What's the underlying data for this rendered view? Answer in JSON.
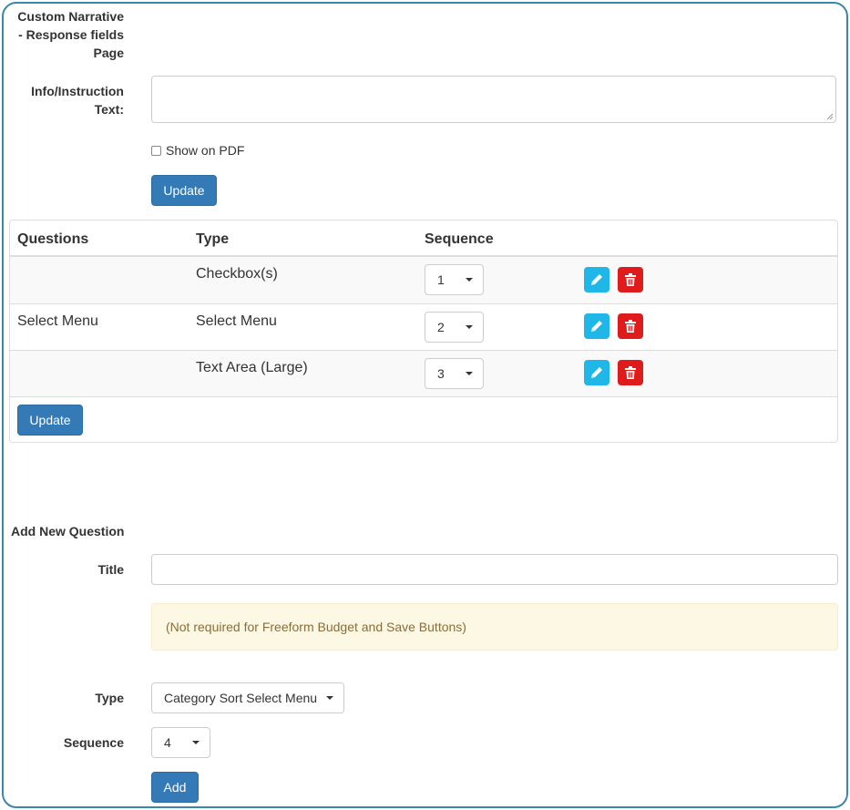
{
  "header": {
    "page_title_line1": "Custom Narrative",
    "page_title_line2": "- Response fields",
    "page_title_line3": "Page"
  },
  "info": {
    "label_line1": "Info/Instruction",
    "label_line2": "Text:",
    "value": "",
    "show_on_pdf_label": "Show on PDF",
    "show_on_pdf_checked": false,
    "update_label": "Update"
  },
  "questions_table": {
    "headers": [
      "Questions",
      "Type",
      "Sequence"
    ],
    "rows": [
      {
        "question": "",
        "type": "Checkbox(s)",
        "sequence": "1"
      },
      {
        "question": "Select Menu",
        "type": "Select Menu",
        "sequence": "2"
      },
      {
        "question": "",
        "type": "Text Area (Large)",
        "sequence": "3"
      }
    ],
    "update_label": "Update",
    "edit_icon": "pencil-icon",
    "delete_icon": "trash-icon",
    "edit_color": "#1fb6e8",
    "delete_color": "#e01b1b"
  },
  "add_question": {
    "heading": "Add New Question",
    "title_label": "Title",
    "title_value": "",
    "note": "(Not required for Freeform Budget and Save Buttons)",
    "type_label": "Type",
    "type_value": "Category Sort Select Menu",
    "sequence_label": "Sequence",
    "sequence_value": "4",
    "add_label": "Add"
  },
  "colors": {
    "primary": "#337ab7",
    "frame_border": "#3a87ad",
    "alert_bg": "#fcf8e3",
    "alert_text": "#8a6d3b"
  }
}
